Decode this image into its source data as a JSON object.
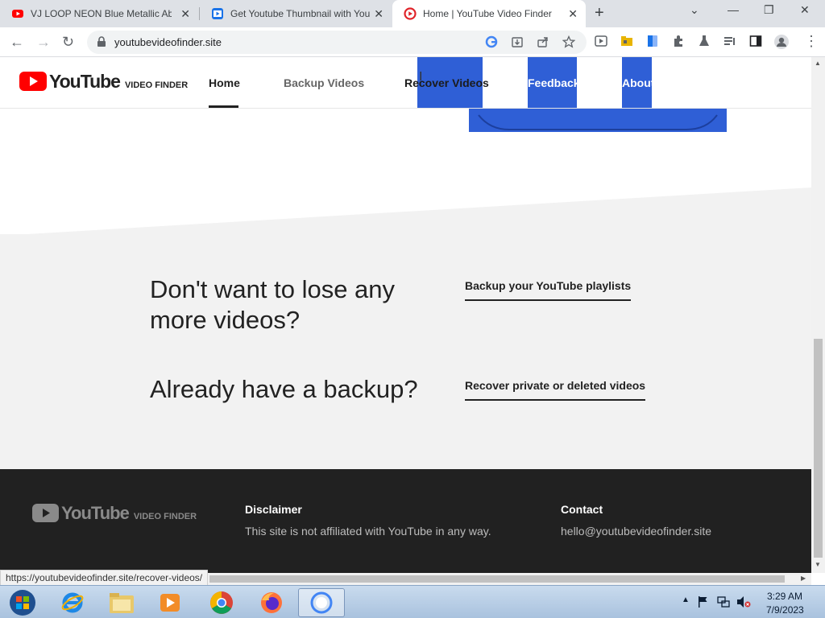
{
  "tabs": [
    {
      "title": "VJ LOOP NEON Blue Metallic Ab",
      "favicon": "youtube-icon"
    },
    {
      "title": "Get Youtube Thumbnail with You",
      "favicon": "thumbnail-icon"
    },
    {
      "title": "Home | YouTube Video Finder",
      "favicon": "video-finder-icon",
      "active": true
    }
  ],
  "address_bar": {
    "url": "youtubevideofinder.site"
  },
  "site": {
    "logo_text": "YouTube",
    "logo_sub": "VIDEO FINDER",
    "nav": [
      "Home",
      "Backup Videos",
      "Recover Videos",
      "Feedback",
      "About"
    ],
    "nav_highlight_color": "#2f5fd6"
  },
  "content": {
    "q1": "Don't want to lose any more videos?",
    "cta1": "Backup your YouTube playlists",
    "q2": "Already have a backup?",
    "cta2": "Recover private or deleted videos"
  },
  "footer": {
    "logo_text": "YouTube",
    "logo_sub": "VIDEO FINDER",
    "disclaimer_heading": "Disclaimer",
    "disclaimer_text": "This site is not affiliated with YouTube in any way.",
    "contact_heading": "Contact",
    "contact_email": "hello@youtubevideofinder.site"
  },
  "status_url": "https://youtubevideofinder.site/recover-videos/",
  "taskbar": {
    "time": "3:29 AM",
    "date": "7/9/2023"
  }
}
